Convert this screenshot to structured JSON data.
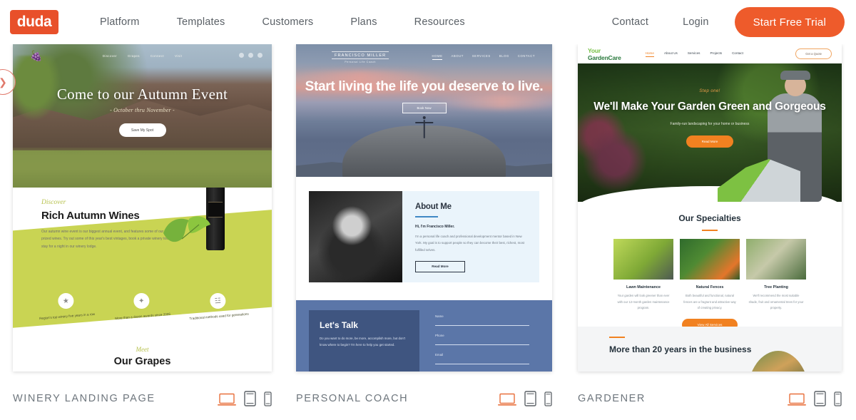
{
  "header": {
    "logo_text": "duda",
    "nav": [
      {
        "label": "Platform"
      },
      {
        "label": "Templates"
      },
      {
        "label": "Customers"
      },
      {
        "label": "Plans"
      },
      {
        "label": "Resources"
      }
    ],
    "contact_label": "Contact",
    "login_label": "Login",
    "trial_label": "Start Free Trial",
    "accent_color": "#EE5B2B",
    "logo_bg": "#E8502A"
  },
  "carousel": {
    "prev_arrow_icon": "chevron-right-icon",
    "arrow_color": "#E0796B"
  },
  "templates": [
    {
      "title": "WINERY LANDING PAGE",
      "devices": [
        "desktop-icon",
        "tablet-icon",
        "mobile-icon"
      ],
      "active_device": "desktop-icon",
      "preview": {
        "logo_icon": "grape-cluster-icon",
        "nav": [
          "Discover",
          "Grapes",
          "Connect",
          "Visit"
        ],
        "social": [
          "facebook-icon",
          "instagram-icon",
          "twitter-icon"
        ],
        "hero_heading": "Come to our Autumn Event",
        "hero_sub": "- October thru November -",
        "hero_cta": "Save My Spot",
        "section_kicker": "Discover",
        "section_heading": "Rich Autumn Wines",
        "section_body": "Our autumn wine event is our biggest annual event, and features some of our most prized wines. Try out some of this year's best vintages, book a private winery tour or stay for a night in our winery lodge.",
        "features": [
          {
            "icon": "award-icon",
            "caption": "Region's top winery five years in a row"
          },
          {
            "icon": "grape-icon",
            "caption": "More than a dozen awards since 2006"
          },
          {
            "icon": "barrel-icon",
            "caption": "Traditional methods used for generations"
          }
        ],
        "footer_kicker": "Meet",
        "footer_heading": "Our Grapes",
        "band_color": "#C9D453"
      }
    },
    {
      "title": "PERSONAL COACH",
      "devices": [
        "desktop-icon",
        "tablet-icon",
        "mobile-icon"
      ],
      "active_device": "desktop-icon",
      "preview": {
        "brand_name": "FRANCISCO MILLER",
        "brand_role": "Personal Life Coach",
        "nav": [
          "HOME",
          "ABOUT",
          "SERVICES",
          "BLOG",
          "CONTACT"
        ],
        "nav_active": "HOME",
        "hero_heading": "Start living the life you deserve to live.",
        "hero_cta": "Book Now",
        "about_heading": "About Me",
        "about_lead": "Hi, I'm Francisco Miller.",
        "about_body": "I'm a personal life coach and professional development mentor based in New York. My goal is to support people so they can become their best, richest, most fulfilled selves.",
        "about_cta": "Read More",
        "talk_heading": "Let's Talk",
        "talk_body": "Do you want to do more, be more, accomplish more, but don't know where to begin? I'm here to help you get started.",
        "form_fields": [
          "Name",
          "Phone",
          "Email"
        ],
        "accent_color": "#3F88C5"
      }
    },
    {
      "title": "GARDENER",
      "devices": [
        "desktop-icon",
        "tablet-icon",
        "mobile-icon"
      ],
      "active_device": "desktop-icon",
      "preview": {
        "logo_text": "GardenCare",
        "logo_leaf": "Your",
        "nav": [
          "Home",
          "About Us",
          "Services",
          "Projects",
          "Contact"
        ],
        "nav_active": "Home",
        "quote_cta": "Get a Quote",
        "hero_kicker": "Step one!",
        "hero_heading": "We'll Make Your Garden Green and Gorgeous",
        "hero_sub": "Family-run landscaping for your home or business",
        "hero_cta": "Read More",
        "spec_heading": "Our Specialties",
        "specialties": [
          {
            "title": "Lawn Maintenance",
            "desc": "Your garden will look greener than ever with our 12-month garden maintenance program."
          },
          {
            "title": "Natural Fences",
            "desc": "Both beautiful and functional, natural fences are a fragrant and attractive way of creating privacy."
          },
          {
            "title": "Tree Planting",
            "desc": "We'll recommend the most suitable shade, fruit and ornamental trees for your property."
          }
        ],
        "spec_cta": "View All Services",
        "years_heading": "More than 20 years in the business",
        "accent_color": "#F18120"
      }
    }
  ]
}
